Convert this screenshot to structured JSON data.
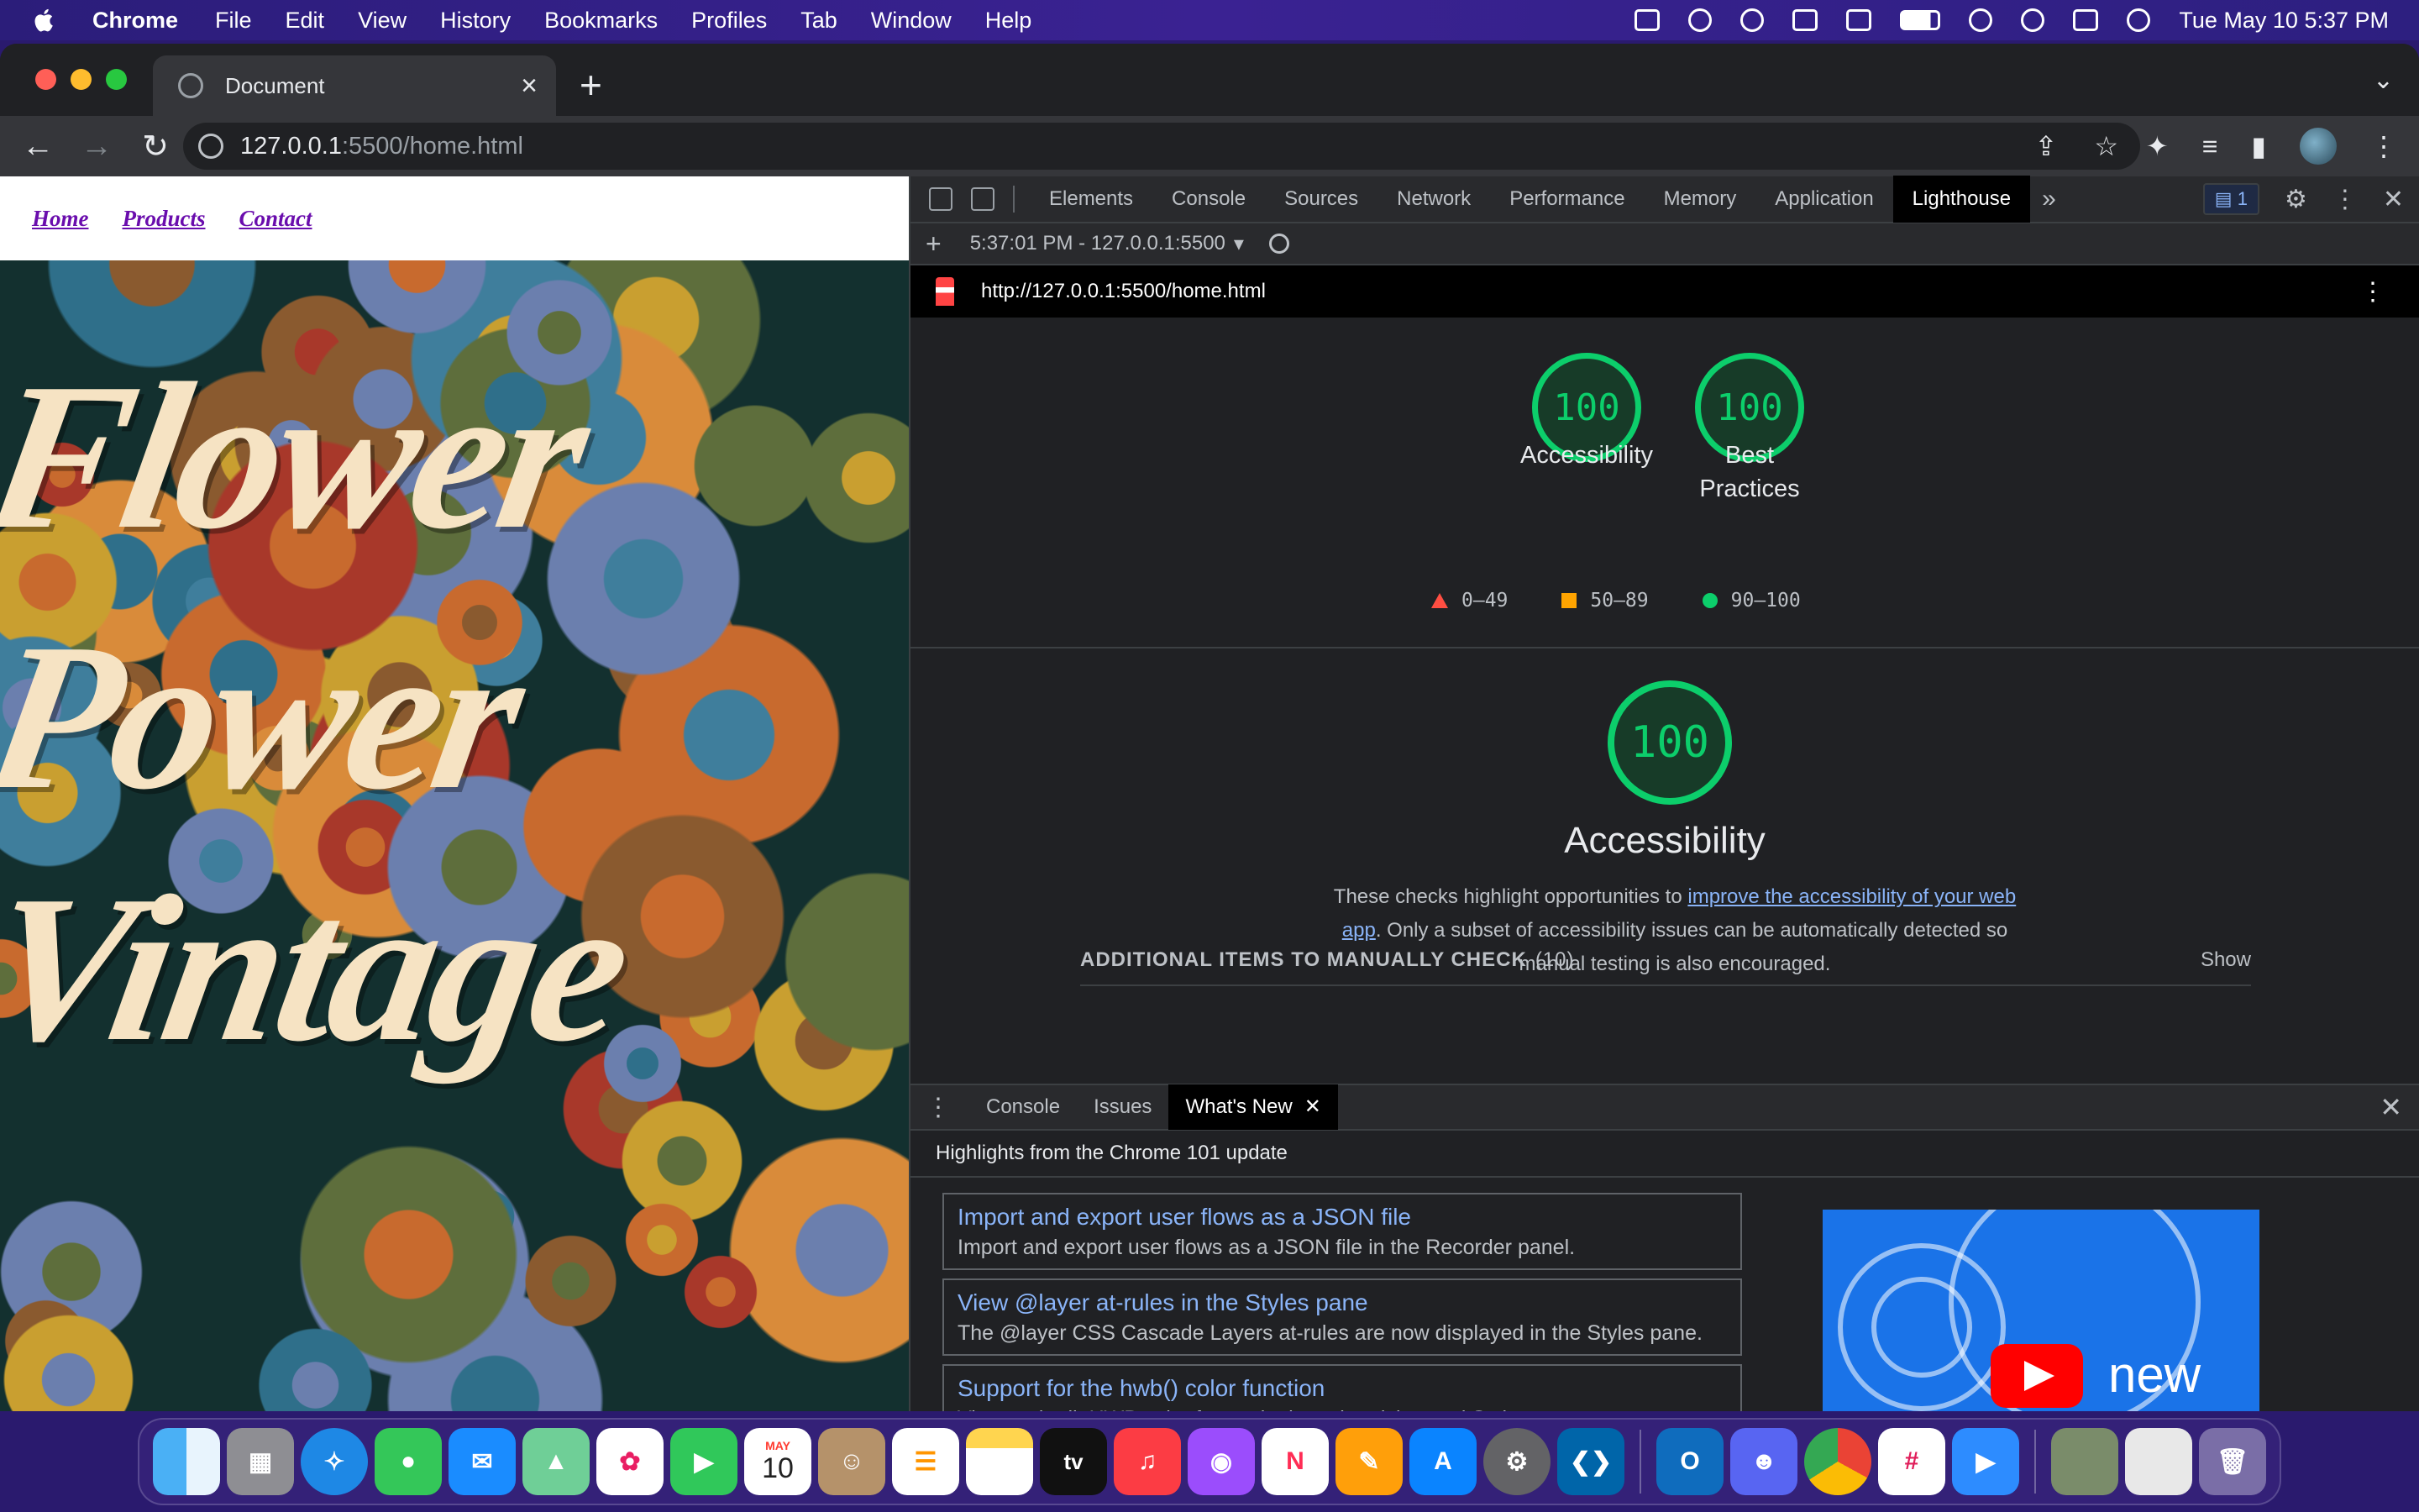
{
  "menubar": {
    "app_name": "Chrome",
    "items": [
      "File",
      "Edit",
      "View",
      "History",
      "Bookmarks",
      "Profiles",
      "Tab",
      "Window",
      "Help"
    ],
    "clock": "Tue May 10  5:37 PM"
  },
  "browser": {
    "tab_title": "Document",
    "url_host": "127.0.0.1",
    "url_path": ":5500/home.html"
  },
  "page": {
    "nav": [
      "Home",
      "Products",
      "Contact"
    ],
    "hero_lines": [
      "Flower",
      "Power",
      "Vintage"
    ]
  },
  "devtools": {
    "tabs": [
      "Elements",
      "Console",
      "Sources",
      "Network",
      "Performance",
      "Memory",
      "Application",
      "Lighthouse"
    ],
    "active_tab": "Lighthouse",
    "issues_count": "1",
    "report_selector": "5:37:01 PM - 127.0.0.1:5500",
    "report_url": "http://127.0.0.1:5500/home.html",
    "scores": [
      {
        "value": "100",
        "label": "Accessibility"
      },
      {
        "value": "100",
        "label": "Best Practices"
      }
    ],
    "legend": [
      "0–49",
      "50–89",
      "90–100"
    ],
    "category": {
      "score": "100",
      "title": "Accessibility",
      "desc_before": "These checks highlight opportunities to ",
      "desc_link": "improve the accessibility of your web app",
      "desc_after": ". Only a subset of accessibility issues can be automatically detected so manual testing is also encouraged."
    },
    "manual_check": {
      "title": "ADDITIONAL ITEMS TO MANUALLY CHECK",
      "count": "(10)",
      "action": "Show"
    },
    "drawer": {
      "tabs": [
        "Console",
        "Issues",
        "What's New"
      ],
      "heading": "Highlights from the Chrome 101 update",
      "cards": [
        {
          "title": "Import and export user flows as a JSON file",
          "desc": "Import and export user flows as a JSON file in the Recorder panel."
        },
        {
          "title": "View @layer at-rules in the Styles pane",
          "desc": "The @layer CSS Cascade Layers at-rules are now displayed in the Styles pane."
        },
        {
          "title": "Support for the hwb() color function",
          "desc": "View and edit HWB color format in the color picker and Styles pane."
        }
      ],
      "video_caption": "new"
    }
  },
  "dock": {
    "apps": [
      "finder",
      "launchpad",
      "safari",
      "messages",
      "mail",
      "maps",
      "photos",
      "facetime",
      "calendar",
      "contacts",
      "reminders",
      "notes",
      "tv",
      "music",
      "podcasts",
      "news",
      "pages",
      "app-store",
      "system-preferences",
      "vscode",
      "outlook",
      "discord",
      "chrome",
      "slack",
      "zoom",
      "downloads",
      "documents",
      "trash"
    ],
    "calendar_month": "MAY",
    "calendar_day": "10",
    "tv_label": "tv"
  },
  "colors": {
    "score_good": "#0cce6b",
    "score_average": "#ffa400",
    "score_fail": "#ff4e42",
    "link": "#8ab4f8",
    "hero_text": "#f6e3c3",
    "nav_link": "#6a0dad"
  }
}
